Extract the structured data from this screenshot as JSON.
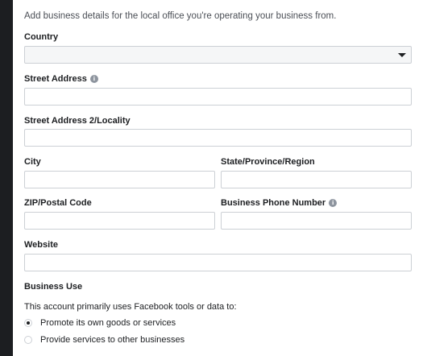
{
  "intro": "Add business details for the local office you're operating your business from.",
  "fields": {
    "country": {
      "label": "Country",
      "value": ""
    },
    "street": {
      "label": "Street Address",
      "value": "",
      "icon": "info-icon"
    },
    "street2": {
      "label": "Street Address 2/Locality",
      "value": ""
    },
    "city": {
      "label": "City",
      "value": ""
    },
    "state": {
      "label": "State/Province/Region",
      "value": ""
    },
    "zip": {
      "label": "ZIP/Postal Code",
      "value": ""
    },
    "phone": {
      "label": "Business Phone Number",
      "value": "",
      "icon": "info-icon"
    },
    "website": {
      "label": "Website",
      "value": ""
    }
  },
  "business_use": {
    "title": "Business Use",
    "question": "This account primarily uses Facebook tools or data to:",
    "options": [
      {
        "label": "Promote its own goods or services",
        "selected": true
      },
      {
        "label": "Provide services to other businesses",
        "selected": false
      }
    ]
  }
}
